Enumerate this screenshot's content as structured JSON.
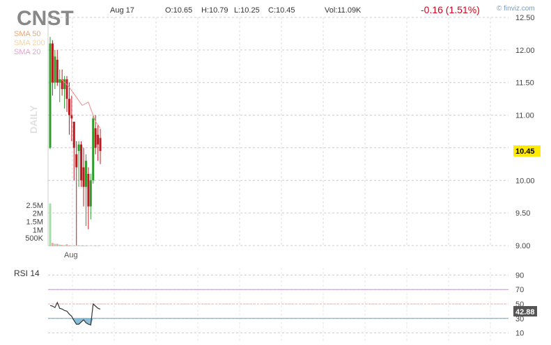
{
  "header": {
    "ticker": "CNST",
    "date": "Aug 17",
    "open": "O:10.65",
    "high": "H:10.79",
    "low": "L:10.25",
    "close": "C:10.45",
    "volume": "Vol:11.09K",
    "change": "-0.16 (1.51%)",
    "brand": "© finviz.com"
  },
  "legend": {
    "sma50": "SMA 50",
    "sma200": "SMA 200",
    "sma20": "SMA 20",
    "period": "DAILY"
  },
  "colors": {
    "up": "#2a9d2a",
    "down": "#c0181f",
    "sma50": "#f5a46b",
    "sma200": "#f7d3a6",
    "sma20": "#e8a2d0",
    "rsi_fill": "#7ab8d4",
    "price_tag": "#ffea00"
  },
  "chart_data": {
    "type": "candlestick",
    "price_axis": {
      "ylim": [
        9.0,
        12.5
      ],
      "ticks": [
        "12.50",
        "12.00",
        "11.50",
        "11.00",
        "10.50",
        "10.00",
        "9.50",
        "9.00"
      ],
      "last_price_tag": "10.45"
    },
    "volume_axis": {
      "ticks": [
        "2.5M",
        "2M",
        "1.5M",
        "1M",
        "500K"
      ]
    },
    "x_axis": {
      "labels": [
        "Aug"
      ]
    },
    "candles": [
      {
        "o": 10.5,
        "h": 12.2,
        "l": 10.48,
        "c": 12.1
      },
      {
        "o": 12.1,
        "h": 12.15,
        "l": 11.3,
        "c": 11.5
      },
      {
        "o": 11.5,
        "h": 12.0,
        "l": 11.4,
        "c": 11.9
      },
      {
        "o": 11.85,
        "h": 12.0,
        "l": 11.45,
        "c": 11.5
      },
      {
        "o": 11.5,
        "h": 11.7,
        "l": 11.2,
        "c": 11.55
      },
      {
        "o": 11.55,
        "h": 11.7,
        "l": 11.3,
        "c": 11.4
      },
      {
        "o": 11.4,
        "h": 11.6,
        "l": 11.1,
        "c": 11.55
      },
      {
        "o": 11.55,
        "h": 11.6,
        "l": 11.05,
        "c": 11.25
      },
      {
        "o": 11.25,
        "h": 11.5,
        "l": 10.7,
        "c": 11.0
      },
      {
        "o": 11.0,
        "h": 11.3,
        "l": 10.6,
        "c": 10.95
      },
      {
        "o": 10.9,
        "h": 10.9,
        "l": 10.0,
        "c": 10.5
      },
      {
        "o": 10.4,
        "h": 10.6,
        "l": 9.0,
        "c": 10.2
      },
      {
        "o": 10.45,
        "h": 10.6,
        "l": 9.9,
        "c": 10.55
      },
      {
        "o": 10.55,
        "h": 10.6,
        "l": 9.9,
        "c": 10.0
      },
      {
        "o": 10.2,
        "h": 10.5,
        "l": 9.6,
        "c": 9.9
      },
      {
        "o": 9.9,
        "h": 10.4,
        "l": 9.3,
        "c": 10.3
      },
      {
        "o": 10.1,
        "h": 10.2,
        "l": 9.25,
        "c": 9.6
      },
      {
        "o": 9.6,
        "h": 10.1,
        "l": 9.4,
        "c": 10.0
      },
      {
        "o": 10.0,
        "h": 11.0,
        "l": 9.95,
        "c": 10.95
      },
      {
        "o": 10.8,
        "h": 11.0,
        "l": 10.4,
        "c": 10.5
      },
      {
        "o": 10.7,
        "h": 10.85,
        "l": 10.3,
        "c": 10.55
      },
      {
        "o": 10.65,
        "h": 10.79,
        "l": 10.25,
        "c": 10.45
      }
    ],
    "sma20": [
      null,
      null,
      null,
      null,
      null,
      null,
      null,
      null,
      null,
      null,
      null,
      null,
      null,
      null,
      null,
      null,
      11.2,
      11.1,
      11.0,
      10.9,
      10.85,
      10.8
    ],
    "volume": [
      2600000,
      200000,
      150000,
      150000,
      100000,
      80000,
      60000,
      120000,
      50000,
      40000,
      30000,
      20000,
      60000,
      30000,
      40000,
      30000,
      20000,
      10000,
      15000,
      20000,
      15000,
      11090
    ],
    "rsi": {
      "label": "RSI 14",
      "ylim": [
        0,
        100
      ],
      "ticks": [
        "90",
        "70",
        "50",
        "30",
        "10"
      ],
      "levels": [
        70,
        50,
        30
      ],
      "last_value": "42.88",
      "values": [
        48,
        47,
        45,
        52,
        44,
        43,
        41,
        40,
        36,
        33,
        27,
        22,
        22,
        25,
        28,
        24,
        22,
        21,
        50,
        47,
        44,
        42.88
      ]
    }
  }
}
